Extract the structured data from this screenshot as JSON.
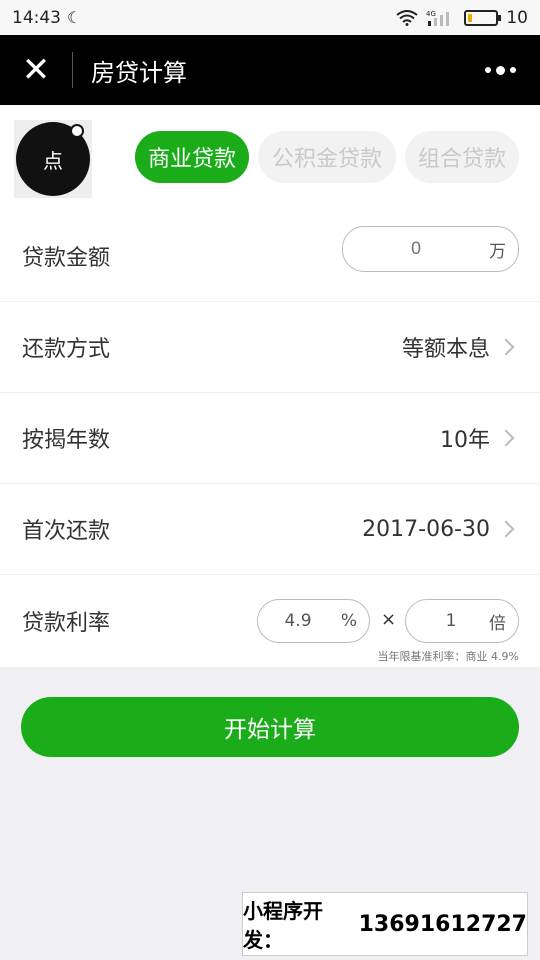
{
  "status_bar": {
    "time": "14:43",
    "battery": "10",
    "network": "4G"
  },
  "nav": {
    "title": "房贷计算",
    "close_icon": "close-icon",
    "more_icon": "more-icon"
  },
  "logo": {
    "text": "点"
  },
  "tabs": [
    {
      "label": "商业贷款",
      "active": true
    },
    {
      "label": "公积金贷款",
      "active": false
    },
    {
      "label": "组合贷款",
      "active": false
    }
  ],
  "form": {
    "amount": {
      "label": "贷款金额",
      "value": "0",
      "unit": "万"
    },
    "method": {
      "label": "还款方式",
      "value": "等额本息"
    },
    "years": {
      "label": "按揭年数",
      "value": "10年"
    },
    "first_payment": {
      "label": "首次还款",
      "value": "2017-06-30"
    },
    "rate": {
      "label": "贷款利率",
      "value": "4.9",
      "unit": "%",
      "times_symbol": "×",
      "multiplier": "1",
      "multiplier_unit": "倍",
      "note": "当年限基准利率：商业 4.9%"
    }
  },
  "calc_button": {
    "label": "开始计算"
  },
  "promo": {
    "label": "小程序开发：",
    "phone": "13691612727"
  },
  "colors": {
    "accent": "#1aad19",
    "nav_bg": "#000000",
    "page_bg": "#efeff4"
  }
}
